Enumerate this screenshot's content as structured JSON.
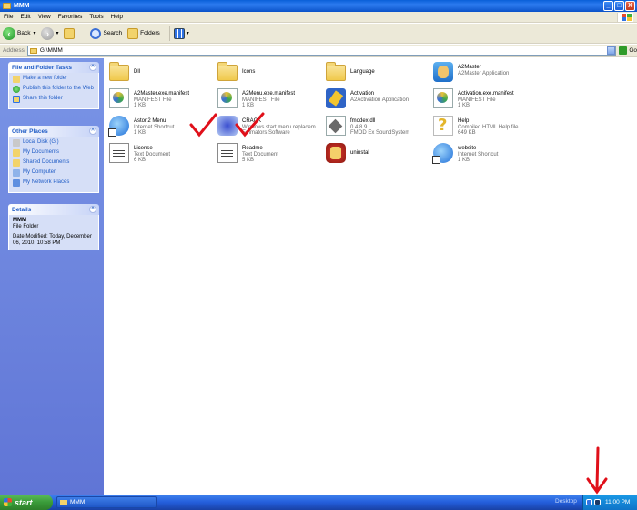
{
  "window": {
    "title": "MMM"
  },
  "window_controls": {
    "minimize": "_",
    "maximize": "□",
    "close": "X"
  },
  "menu": [
    "File",
    "Edit",
    "View",
    "Favorites",
    "Tools",
    "Help"
  ],
  "toolbar": {
    "back": "Back",
    "search": "Search",
    "folders": "Folders"
  },
  "address": {
    "label": "Address",
    "value": "G:\\MMM",
    "go": "Go"
  },
  "tasks_panel": {
    "title": "File and Folder Tasks",
    "items": [
      "Make a new folder",
      "Publish this folder to the Web",
      "Share this folder"
    ]
  },
  "places_panel": {
    "title": "Other Places",
    "items": [
      "Local Disk (G:)",
      "My Documents",
      "Shared Documents",
      "My Computer",
      "My Network Places"
    ]
  },
  "details_panel": {
    "title": "Details",
    "name": "MMM",
    "type": "File Folder",
    "modified": "Date Modified: Today, December 06, 2010, 10:58 PM"
  },
  "files": [
    {
      "name": "Dll",
      "type": "",
      "size": "",
      "icon": "folder-icon"
    },
    {
      "name": "Icons",
      "type": "",
      "size": "",
      "icon": "folder-icon"
    },
    {
      "name": "Language",
      "type": "",
      "size": "",
      "icon": "folder-icon"
    },
    {
      "name": "A2Master",
      "type": "A2Master Application",
      "size": "",
      "icon": "app-icon"
    },
    {
      "name": "A2Master.exe.manifest",
      "type": "MANIFEST File",
      "size": "1 KB",
      "icon": "manifest-icon"
    },
    {
      "name": "A2Menu.exe.manifest",
      "type": "MANIFEST File",
      "size": "1 KB",
      "icon": "manifest-icon"
    },
    {
      "name": "Activation",
      "type": "A2Activation Application",
      "size": "",
      "icon": "activation-icon"
    },
    {
      "name": "Activation.exe.manifest",
      "type": "MANIFEST File",
      "size": "1 KB",
      "icon": "manifest-icon"
    },
    {
      "name": "Aston2 Menu",
      "type": "Internet Shortcut",
      "size": "1 KB",
      "icon": "internet-shortcut-icon"
    },
    {
      "name": "CRACK",
      "type": "Windows start menu replacem...",
      "size": "Emmators Software",
      "icon": "crack-icon"
    },
    {
      "name": "fmodex.dll",
      "type": "0.4.8.9",
      "size": "FMOD Ex SoundSystem",
      "icon": "dll-icon"
    },
    {
      "name": "Help",
      "type": "Compiled HTML Help file",
      "size": "649 KB",
      "icon": "help-icon"
    },
    {
      "name": "License",
      "type": "Text Document",
      "size": "6 KB",
      "icon": "text-document-icon"
    },
    {
      "name": "Readme",
      "type": "Text Document",
      "size": "5 KB",
      "icon": "text-document-icon"
    },
    {
      "name": "uninstal",
      "type": "",
      "size": "",
      "icon": "uninstall-icon"
    },
    {
      "name": "website",
      "type": "Internet Shortcut",
      "size": "1 KB",
      "icon": "internet-shortcut-icon"
    }
  ],
  "taskbar": {
    "start": "start",
    "window_button": "MMM",
    "desktop": "Desktop",
    "time": "11:00 PM"
  },
  "colors": {
    "annotation_red": "#e0101a",
    "titlebar_blue": "#0a52c9",
    "taskpane_blue": "#6f86de"
  }
}
